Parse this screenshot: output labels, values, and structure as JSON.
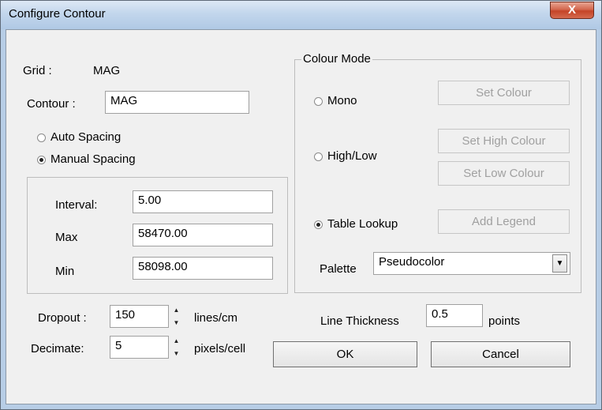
{
  "window": {
    "title": "Configure Contour",
    "close_label": "X"
  },
  "grid": {
    "label": "Grid :",
    "value": "MAG"
  },
  "contour": {
    "label": "Contour :",
    "value": "MAG"
  },
  "spacing": {
    "auto_label": "Auto Spacing",
    "manual_label": "Manual Spacing",
    "selected": "manual"
  },
  "interval": {
    "label": "Interval:",
    "value": "5.00"
  },
  "max": {
    "label": "Max",
    "value": "58470.00"
  },
  "min": {
    "label": "Min",
    "value": "58098.00"
  },
  "colour_mode": {
    "caption": "Colour Mode",
    "mono_label": "Mono",
    "highlow_label": "High/Low",
    "table_label": "Table Lookup",
    "selected": "table",
    "set_colour": "Set Colour",
    "set_high_colour": "Set High Colour",
    "set_low_colour": "Set Low Colour",
    "add_legend": "Add Legend",
    "palette_label": "Palette",
    "palette_value": "Pseudocolor"
  },
  "dropout": {
    "label": "Dropout :",
    "value": "150",
    "unit": "lines/cm"
  },
  "decimate": {
    "label": "Decimate:",
    "value": "5",
    "unit": "pixels/cell"
  },
  "line_thickness": {
    "label": "Line Thickness",
    "value": "0.5",
    "unit": "points"
  },
  "buttons": {
    "ok": "OK",
    "cancel": "Cancel"
  }
}
